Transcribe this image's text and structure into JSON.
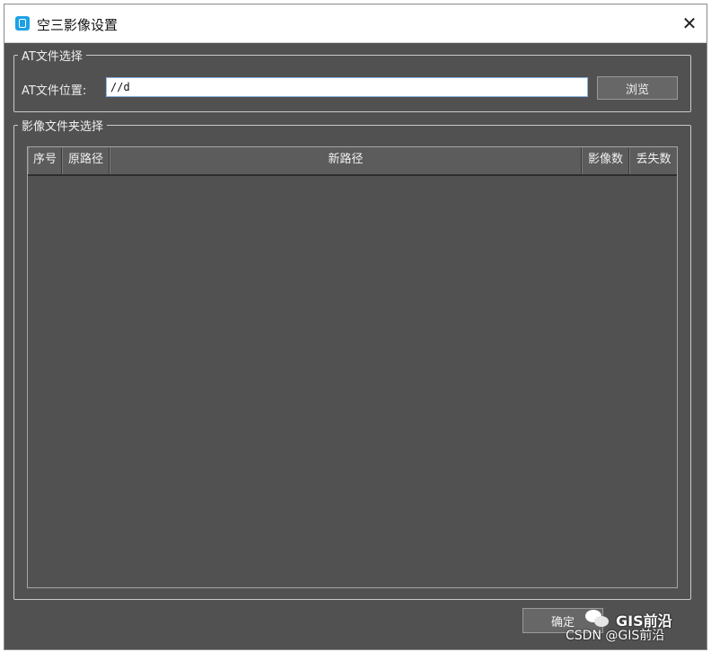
{
  "window": {
    "title": "空三影像设置",
    "close_glyph": "✕"
  },
  "at_group": {
    "legend": "AT文件选择",
    "label": "AT文件位置:",
    "input_value": "//d",
    "browse_label": "浏览"
  },
  "image_group": {
    "legend": "影像文件夹选择",
    "columns": [
      "序号",
      "原路径",
      "新路径",
      "影像数",
      "丢失数"
    ],
    "rows": []
  },
  "footer": {
    "ok_label": "确定"
  },
  "watermark": {
    "wechat_text": "GIS前沿",
    "csdn_text": "CSDN @GIS前沿"
  }
}
